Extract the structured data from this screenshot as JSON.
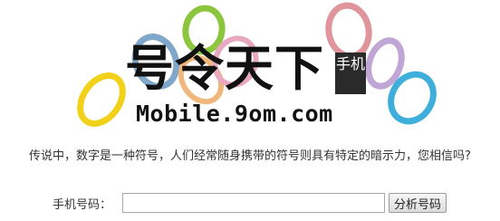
{
  "logo": {
    "title": "号令天下",
    "badge": "手机",
    "domain": "Mobile.9om.com",
    "ring_colors": [
      "#f2d11b",
      "#8cc63f",
      "#7fa7c9",
      "#e8a8c0",
      "#e0949c",
      "#c0a6d4",
      "#3eaedb",
      "#f0b77c"
    ]
  },
  "intro": {
    "question": "传说中，数字是一种符号，人们经常随身携带的符号则具有特定的暗示力，您相信吗?"
  },
  "form": {
    "label": "手机号码：",
    "input_value": "",
    "button_label": "分析号码"
  }
}
